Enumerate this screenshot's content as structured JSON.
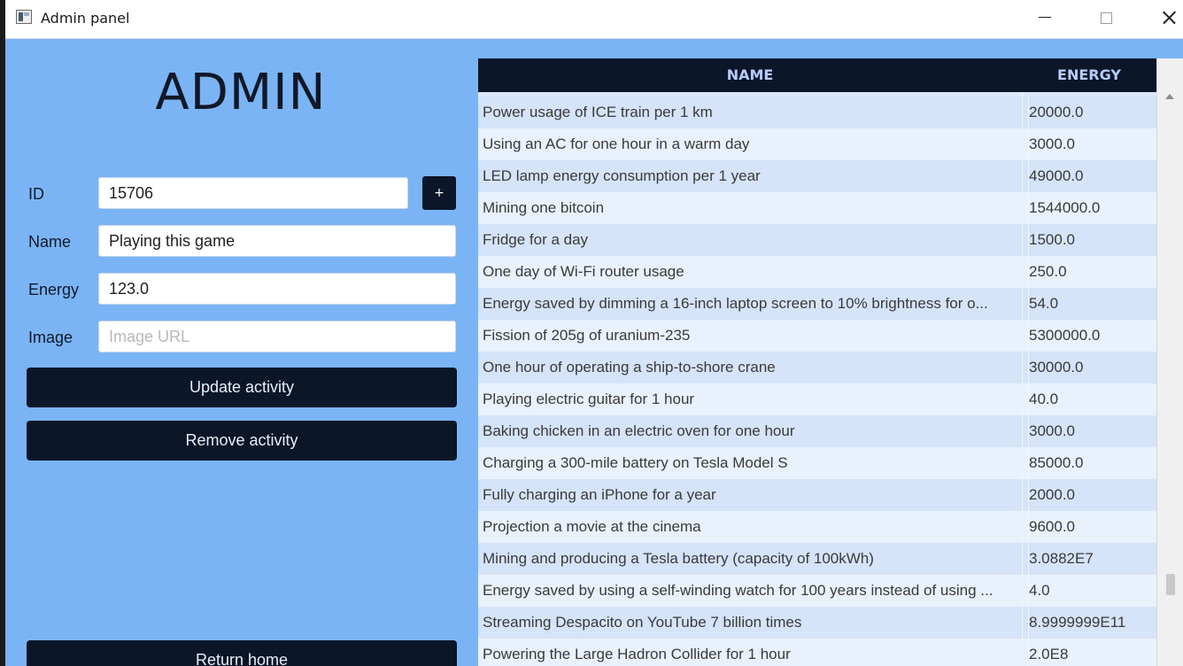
{
  "window": {
    "title": "Admin panel"
  },
  "header": {
    "title": "ADMIN"
  },
  "form": {
    "id_label": "ID",
    "id_value": "15706",
    "add_label": "+",
    "name_label": "Name",
    "name_value": "Playing this game",
    "energy_label": "Energy",
    "energy_value": "123.0",
    "image_label": "Image",
    "image_value": "",
    "image_placeholder": "Image URL"
  },
  "buttons": {
    "update": "Update activity",
    "remove": "Remove activity",
    "return_home": "Return home"
  },
  "table": {
    "columns": [
      "NAME",
      "ENERGY"
    ],
    "rows": [
      {
        "name": "Power usage of ICE train per 1 km",
        "energy": "20000.0"
      },
      {
        "name": "Using an AC for one hour in a warm day",
        "energy": "3000.0"
      },
      {
        "name": "LED lamp energy consumption per 1 year",
        "energy": "49000.0"
      },
      {
        "name": "Mining one bitcoin",
        "energy": "1544000.0"
      },
      {
        "name": "Fridge for a day",
        "energy": "1500.0"
      },
      {
        "name": "One day of Wi-Fi router usage",
        "energy": "250.0"
      },
      {
        "name": "Energy saved by dimming a 16-inch laptop screen to 10% brightness for o...",
        "energy": "54.0"
      },
      {
        "name": "Fission of 205g of uranium-235",
        "energy": "5300000.0"
      },
      {
        "name": "One hour of operating a ship-to-shore crane",
        "energy": "30000.0"
      },
      {
        "name": "Playing electric guitar for 1 hour",
        "energy": "40.0"
      },
      {
        "name": "Baking chicken in an electric oven for one hour",
        "energy": "3000.0"
      },
      {
        "name": "Charging a 300-mile battery on Tesla Model S",
        "energy": "85000.0"
      },
      {
        "name": "Fully charging an iPhone for a year",
        "energy": "2000.0"
      },
      {
        "name": "Projection a movie at the cinema",
        "energy": "9600.0"
      },
      {
        "name": "Mining and producing a Tesla battery (capacity of 100kWh)",
        "energy": "3.0882E7"
      },
      {
        "name": "Energy saved by using a self-winding watch for 100 years instead of using ...",
        "energy": "4.0"
      },
      {
        "name": "Streaming Despacito on YouTube 7 billion times",
        "energy": "8.9999999E11"
      },
      {
        "name": "Powering the Large Hadron Collider for 1 hour",
        "energy": "2.0E8"
      }
    ]
  },
  "icons": {
    "app": "app-window-icon",
    "minimize": "minimize-icon",
    "maximize": "maximize-icon",
    "close": "close-icon"
  },
  "colors": {
    "background": "#7ab4f5",
    "dark_button": "#0b1628",
    "table_header": "#0b1628",
    "header_text": "#b8ccff"
  }
}
